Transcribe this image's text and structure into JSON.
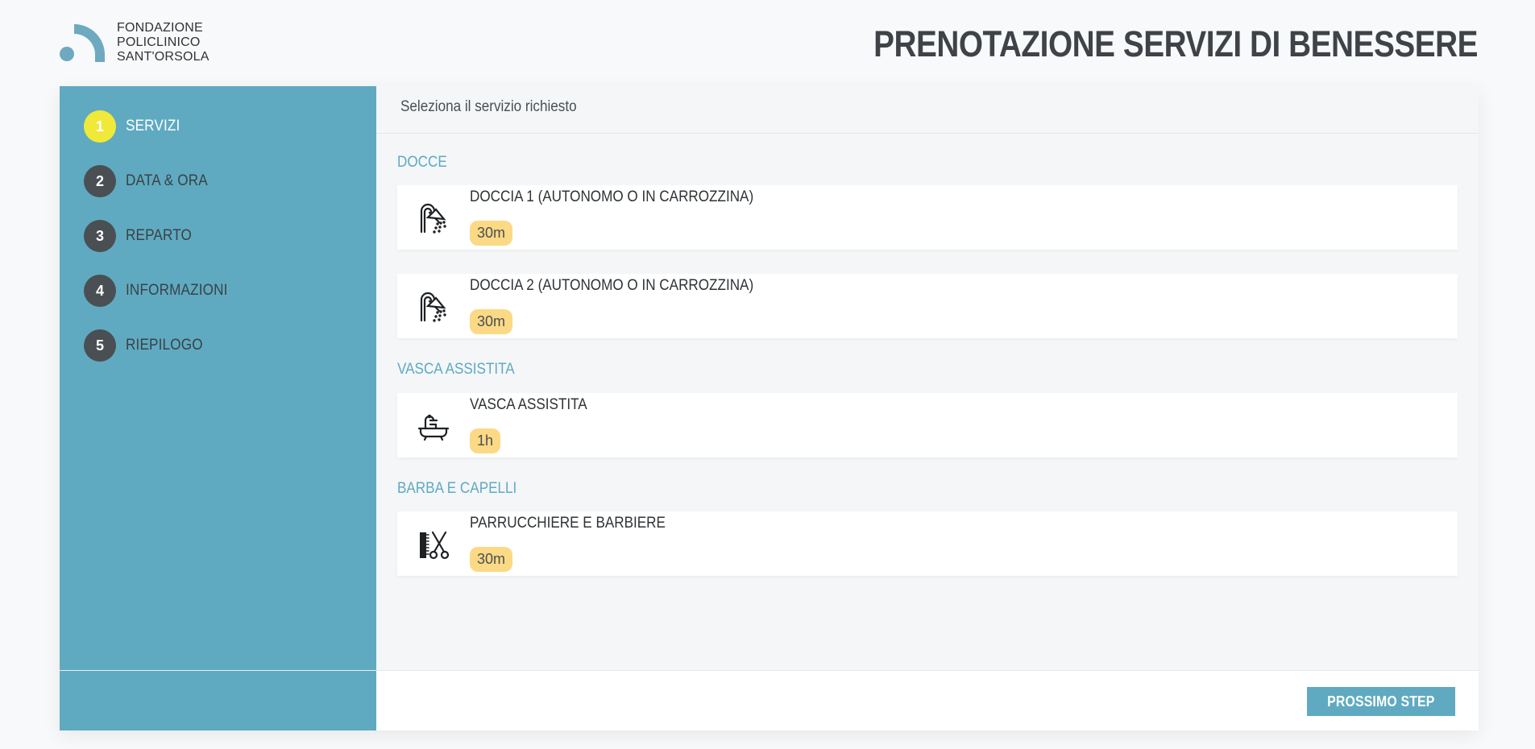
{
  "header": {
    "logo_lines": [
      "FONDAZIONE",
      "POLICLINICO",
      "SANT'ORSOLA"
    ],
    "title": "PRENOTAZIONE SERVIZI DI BENESSERE"
  },
  "colors": {
    "accent": "#5faac1",
    "active_step": "#f0e93a",
    "step_inactive": "#4a4f53",
    "badge": "#fbd985"
  },
  "steps": [
    {
      "num": "1",
      "label": "SERVIZI",
      "active": true
    },
    {
      "num": "2",
      "label": "DATA & ORA",
      "active": false
    },
    {
      "num": "3",
      "label": "REPARTO",
      "active": false
    },
    {
      "num": "4",
      "label": "INFORMAZIONI",
      "active": false
    },
    {
      "num": "5",
      "label": "RIEPILOGO",
      "active": false
    }
  ],
  "content": {
    "heading": "Seleziona il servizio richiesto",
    "categories": [
      {
        "name": "DOCCE",
        "services": [
          {
            "name": "DOCCIA 1 (AUTONOMO O IN CARROZZINA)",
            "duration": "30m",
            "icon": "shower-icon"
          },
          {
            "name": "DOCCIA 2 (AUTONOMO O IN CARROZZINA)",
            "duration": "30m",
            "icon": "shower-icon"
          }
        ]
      },
      {
        "name": "VASCA ASSISTITA",
        "services": [
          {
            "name": "VASCA ASSISTITA",
            "duration": "1h",
            "icon": "bathtub-icon"
          }
        ]
      },
      {
        "name": "BARBA E CAPELLI",
        "services": [
          {
            "name": "PARRUCCHIERE E BARBIERE",
            "duration": "30m",
            "icon": "comb-scissors-icon"
          }
        ]
      }
    ]
  },
  "footer": {
    "next_label": "PROSSIMO STEP"
  }
}
